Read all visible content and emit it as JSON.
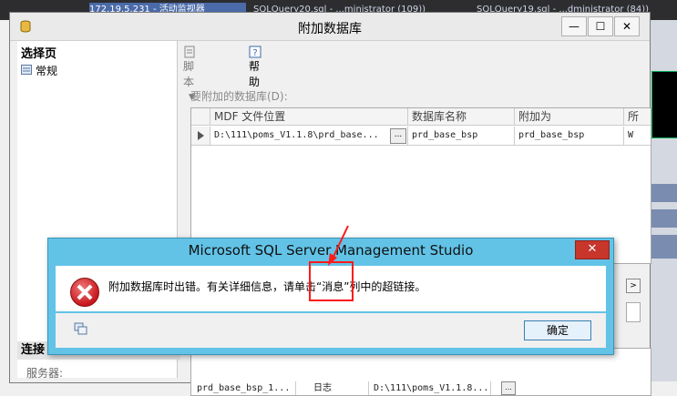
{
  "background": {
    "tabs": [
      "172.19.5.231 - 活动监视器",
      "SQLQuery20.sql - ...ministrator (109))",
      "SQLQuery19.sql - ...dministrator (84))"
    ]
  },
  "attach_window": {
    "title": "附加数据库",
    "controls": {
      "minimize": "—",
      "maximize": "☐",
      "close": "✕"
    },
    "left_pane": {
      "select_page": "选择页",
      "general": "常规",
      "connection": "连接",
      "server_label": "服务器:"
    },
    "toolbar": {
      "script": "脚本",
      "help": "帮助"
    },
    "databases_label": "要附加的数据库(D):",
    "grid": {
      "columns": [
        "MDF 文件位置",
        "数据库名称",
        "附加为",
        "所"
      ],
      "rows": [
        {
          "mdf": "D:\\111\\poms_V1.1.8\\prd_base...",
          "browse": "...",
          "db_name": "prd_base_bsp",
          "attach_as": "prd_base_bsp",
          "extra": "W"
        }
      ]
    },
    "scroll_right": ">",
    "detail_row": {
      "name": "prd_base_bsp_1...",
      "type": "日志",
      "path": "D:\\111\\poms_V1.1.8...",
      "browse": "..."
    }
  },
  "error_dialog": {
    "title": "Microsoft SQL Server Management Studio",
    "close": "✕",
    "message": "附加数据库时出错。有关详细信息，请单击“消息”列中的超链接。",
    "ok": "确定"
  },
  "colors": {
    "dialog_frame": "#62c3e7",
    "annotation": "#ff1a1a",
    "close_button": "#c7352b"
  }
}
